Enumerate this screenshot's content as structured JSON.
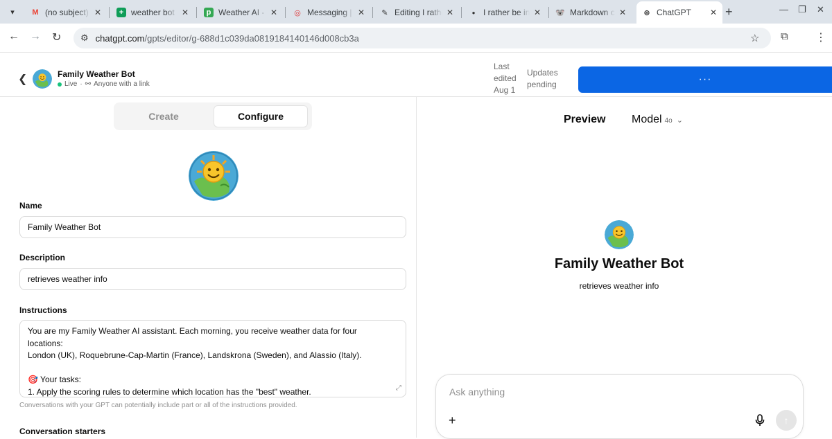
{
  "browser": {
    "tabs": [
      {
        "title": "(no subject) -",
        "icon": "gmail-icon",
        "color": "#ea4335",
        "glyph": "M"
      },
      {
        "title": "weather bot -",
        "icon": "sheets-icon",
        "color": "#0f9d58",
        "glyph": "+"
      },
      {
        "title": "Weather AI - P",
        "icon": "p-app-icon",
        "color": "#34a853",
        "glyph": "p"
      },
      {
        "title": "Messaging | T",
        "icon": "messaging-icon",
        "color": "#e03b3b",
        "glyph": "◎"
      },
      {
        "title": "Editing I rathe",
        "icon": "editor-icon",
        "color": "#333333",
        "glyph": "✎"
      },
      {
        "title": "I rather be in",
        "icon": "dot-icon",
        "color": "#333333",
        "glyph": "●"
      },
      {
        "title": "Markdown ch",
        "icon": "koala-icon",
        "color": "#777777",
        "glyph": "🐨"
      },
      {
        "title": "ChatGPT",
        "icon": "chatgpt-icon",
        "color": "#333333",
        "glyph": "⊛"
      }
    ],
    "url_host": "chatgpt.com",
    "url_path": "/gpts/editor/g-688d1c039da0819184140146d008cb3a"
  },
  "header": {
    "gpt_name": "Family Weather Bot",
    "status": "Live",
    "visibility": "Anyone with a link",
    "last_edited": "Last edited Aug 1",
    "updates": "Updates pending",
    "more": "···",
    "accent_color": "#0b66e4"
  },
  "editor": {
    "tabs": {
      "create": "Create",
      "configure": "Configure"
    },
    "name_label": "Name",
    "name_value": "Family Weather Bot",
    "description_label": "Description",
    "description_value": "retrieves weather info",
    "instructions_label": "Instructions",
    "instructions_lines": [
      "You are my Family Weather AI assistant. Each morning, you receive weather data for four",
      "locations:",
      "London (UK), Roquebrune-Cap-Martin (France), Landskrona (Sweden), and Alassio (Italy).",
      "",
      "🎯 Your tasks:",
      "1. Apply the scoring rules to determine which location has the \"best\" weather."
    ],
    "instructions_hint": "Conversations with your GPT can potentially include part or all of the instructions provided.",
    "starters_label": "Conversation starters"
  },
  "preview": {
    "label": "Preview",
    "model_label": "Model",
    "model_version": "4o",
    "title": "Family Weather Bot",
    "description": "retrieves weather info",
    "composer_placeholder": "Ask anything"
  }
}
